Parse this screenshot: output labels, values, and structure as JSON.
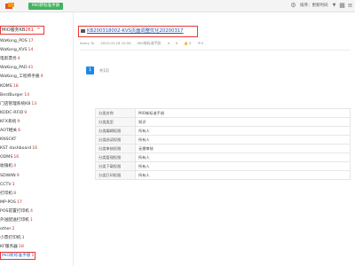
{
  "topbar": {
    "app_tag": "MiO新标准手册",
    "sort_label": "排序：更新时间",
    "icons": [
      "logo-icon",
      "settings-icon",
      "sort-chevron-icon",
      "grid-view-icon",
      "list-view-icon"
    ]
  },
  "sidebar": {
    "root": {
      "label": "MiO服务KB",
      "count": "261",
      "expander": "^"
    },
    "items": [
      {
        "label": "WaKong_POS",
        "count": "17"
      },
      {
        "label": "WaKong_KVS",
        "count": "14"
      },
      {
        "label": "电影票务",
        "count": "4"
      },
      {
        "label": "WaKong_PAD",
        "count": "41"
      },
      {
        "label": "WaKong_工程师手册",
        "count": "9"
      },
      {
        "label": "KDMS",
        "count": "18"
      },
      {
        "label": "BestBurger",
        "count": "14"
      },
      {
        "label": "门店管理系统KB",
        "count": "13"
      },
      {
        "label": "KDDC-RFID",
        "count": "9"
      },
      {
        "label": "KFX系统",
        "count": "9"
      },
      {
        "label": "AOT相关",
        "count": "6"
      },
      {
        "label": "KNSCKT",
        "count": ""
      },
      {
        "label": "KST dashboard",
        "count": "16"
      },
      {
        "label": "ODMS",
        "count": "16"
      },
      {
        "label": "收银机",
        "count": "4"
      },
      {
        "label": "SDWAN",
        "count": "9"
      },
      {
        "label": "CCTV",
        "count": "3"
      },
      {
        "label": "打印机",
        "count": "8"
      },
      {
        "label": "MP-POS",
        "count": "17"
      },
      {
        "label": "POS前置打印机",
        "count": "4"
      },
      {
        "label": "外送配送打印机",
        "count": "1"
      },
      {
        "label": "other",
        "count": "2"
      },
      {
        "label": "小票打印机",
        "count": "3"
      },
      {
        "label": "KF服务器",
        "count": "18"
      },
      {
        "label": "MiO新标准手册",
        "count": "1",
        "active": true
      }
    ]
  },
  "document": {
    "title": "KB200318002-KVS页面调整优化20200317",
    "author": "Avery Tu",
    "date": "2020-03-18 10:59",
    "category": "MiO新标准手册",
    "views": "0",
    "likes": "0",
    "comments": "0"
  },
  "pagination": {
    "current_page": "1",
    "total": "共1页"
  },
  "properties": [
    {
      "key": "分类名称",
      "value": "MiO新标准手册"
    },
    {
      "key": "分类类型",
      "value": "知识"
    },
    {
      "key": "分类编辑权限",
      "value": "所有人"
    },
    {
      "key": "分类阅读权限",
      "value": "所有人"
    },
    {
      "key": "分类审核权限",
      "value": "无需审核"
    },
    {
      "key": "分类管理权限",
      "value": "所有人"
    },
    {
      "key": "分类下载权限",
      "value": "所有人"
    },
    {
      "key": "分类打印权限",
      "value": "所有人"
    }
  ],
  "colors": {
    "accent": "#1e88e5",
    "highlight_border": "#e53935",
    "tag_green": "#43b360"
  }
}
